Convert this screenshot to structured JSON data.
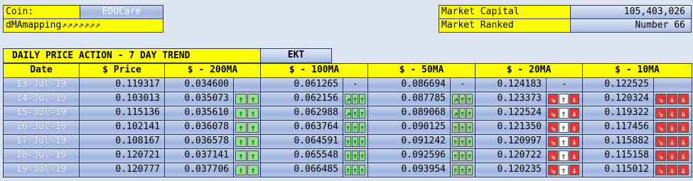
{
  "coin": {
    "label": "Coin:",
    "value": "EDUCare"
  },
  "mapping_label": "dMAmapping⇗⇗⇗⇗⇗⇗⇗",
  "market_capital": {
    "label": "Market Capital",
    "value": "105,403,026"
  },
  "market_ranked": {
    "label": "Market Ranked",
    "value": "Number 66"
  },
  "section_title": "DAILY PRICE ACTION - 7 DAY TREND",
  "ticker": "EKT",
  "columns": [
    "Date",
    "$ Price",
    "$ - 200MA",
    "$ - 100MA",
    "$ - 50MA",
    "$ - 20MA",
    "$ - 10MA"
  ],
  "rows": [
    {
      "date": "13-Jul-19",
      "price": "0.119317",
      "ma200": "0.034600",
      "ma100": "0.061265",
      "ma50": "0.086694",
      "ma20": "0.124183",
      "ma10": "0.122525",
      "i200": [],
      "i100": [
        "-"
      ],
      "i50": [
        "-"
      ],
      "i20": [
        "-"
      ],
      "i10": []
    },
    {
      "date": "14-Jul-19",
      "price": "0.103013",
      "ma200": "0.035073",
      "ma100": "0.062156",
      "ma50": "0.087785",
      "ma20": "0.123373",
      "ma10": "0.120324",
      "i200": [
        "⇑",
        "⇑"
      ],
      "i100": [
        "⇗",
        "⇑",
        "⇑"
      ],
      "i50": [
        "⇗",
        "⇑",
        "⇑"
      ],
      "i20": [
        "⇘",
        "⇑",
        "⇓"
      ],
      "i10": [
        "⇘",
        "⇓",
        "⇓"
      ]
    },
    {
      "date": "15-Jul-19",
      "price": "0.115136",
      "ma200": "0.035610",
      "ma100": "0.062988",
      "ma50": "0.089068",
      "ma20": "0.122524",
      "ma10": "0.119322",
      "i200": [
        "⇑",
        "⇑"
      ],
      "i100": [
        "⇗",
        "⇑",
        "⇑"
      ],
      "i50": [
        "⇗",
        "⇑",
        "⇑"
      ],
      "i20": [
        "⇘",
        "⇑",
        "⇓"
      ],
      "i10": [
        "⇘",
        "⇓",
        "⇓"
      ]
    },
    {
      "date": "16-Jul-19",
      "price": "0.102141",
      "ma200": "0.036078",
      "ma100": "0.063764",
      "ma50": "0.090125",
      "ma20": "0.121350",
      "ma10": "0.117456",
      "i200": [
        "⇑",
        "⇑"
      ],
      "i100": [
        "⇑",
        "⇑",
        "⇑"
      ],
      "i50": [
        "⇑",
        "⇑",
        "⇑"
      ],
      "i20": [
        "⇘",
        "⇑",
        "⇓"
      ],
      "i10": [
        "⇘",
        "⇓",
        "⇓"
      ]
    },
    {
      "date": "17-Jul-19",
      "price": "0.108167",
      "ma200": "0.036578",
      "ma100": "0.064591",
      "ma50": "0.091242",
      "ma20": "0.120997",
      "ma10": "0.115882",
      "i200": [
        "⇑",
        "⇑"
      ],
      "i100": [
        "⇑",
        "⇑",
        "⇑"
      ],
      "i50": [
        "⇑",
        "⇑",
        "⇑"
      ],
      "i20": [
        "⇘",
        "⇑",
        "⇓"
      ],
      "i10": [
        "⇘",
        "⇓",
        "⇓"
      ]
    },
    {
      "date": "18-Jul-19",
      "price": "0.120721",
      "ma200": "0.037141",
      "ma100": "0.065548",
      "ma50": "0.092596",
      "ma20": "0.120722",
      "ma10": "0.115158",
      "i200": [
        "⇑",
        "⇑"
      ],
      "i100": [
        "⇑",
        "⇑",
        "⇑"
      ],
      "i50": [
        "⇑",
        "⇑",
        "⇑"
      ],
      "i20": [
        "⇘",
        "⇑",
        "⇓"
      ],
      "i10": [
        "⇘",
        "⇓",
        "⇓"
      ]
    },
    {
      "date": "19-Jul-19",
      "price": "0.120777",
      "ma200": "0.037706",
      "ma100": "0.066485",
      "ma50": "0.093954",
      "ma20": "0.120235",
      "ma10": "0.115012",
      "i200": [
        "⇑",
        "⇑"
      ],
      "i100": [
        "⇑",
        "⇑",
        "⇑"
      ],
      "i50": [
        "⇑",
        "⇑",
        "⇑"
      ],
      "i20": [
        "⇘",
        "⇑",
        "⇓"
      ],
      "i10": [
        "⇘",
        "⇓",
        "⇓"
      ]
    }
  ],
  "colors": {
    "up": "#8fe08f",
    "down": "#ee3333",
    "header": "#ffff00",
    "cell": "#b7c7e8"
  }
}
